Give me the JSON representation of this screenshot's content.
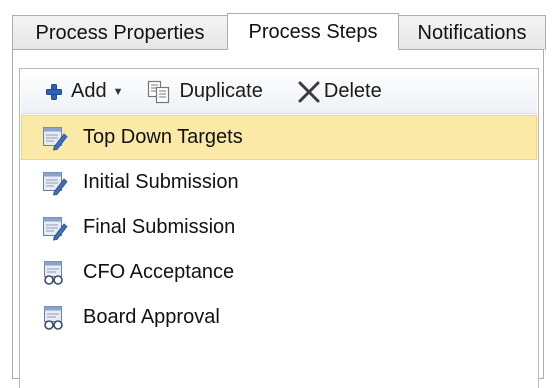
{
  "tabs": [
    {
      "label": "Process Properties",
      "active": false
    },
    {
      "label": "Process Steps",
      "active": true
    },
    {
      "label": "Notifications",
      "active": false
    }
  ],
  "toolbar": {
    "add_label": "Add",
    "duplicate_label": "Duplicate",
    "delete_label": "Delete"
  },
  "steps": [
    {
      "label": "Top Down Targets",
      "icon": "form-edit-icon",
      "selected": true
    },
    {
      "label": "Initial Submission",
      "icon": "form-edit-icon",
      "selected": false
    },
    {
      "label": "Final Submission",
      "icon": "form-edit-icon",
      "selected": false
    },
    {
      "label": "CFO Acceptance",
      "icon": "form-review-icon",
      "selected": false
    },
    {
      "label": "Board Approval",
      "icon": "form-review-icon",
      "selected": false
    }
  ],
  "colors": {
    "selected_bg": "#fbe9a7",
    "add_icon": "#2f62b5",
    "border": "#adadad"
  }
}
